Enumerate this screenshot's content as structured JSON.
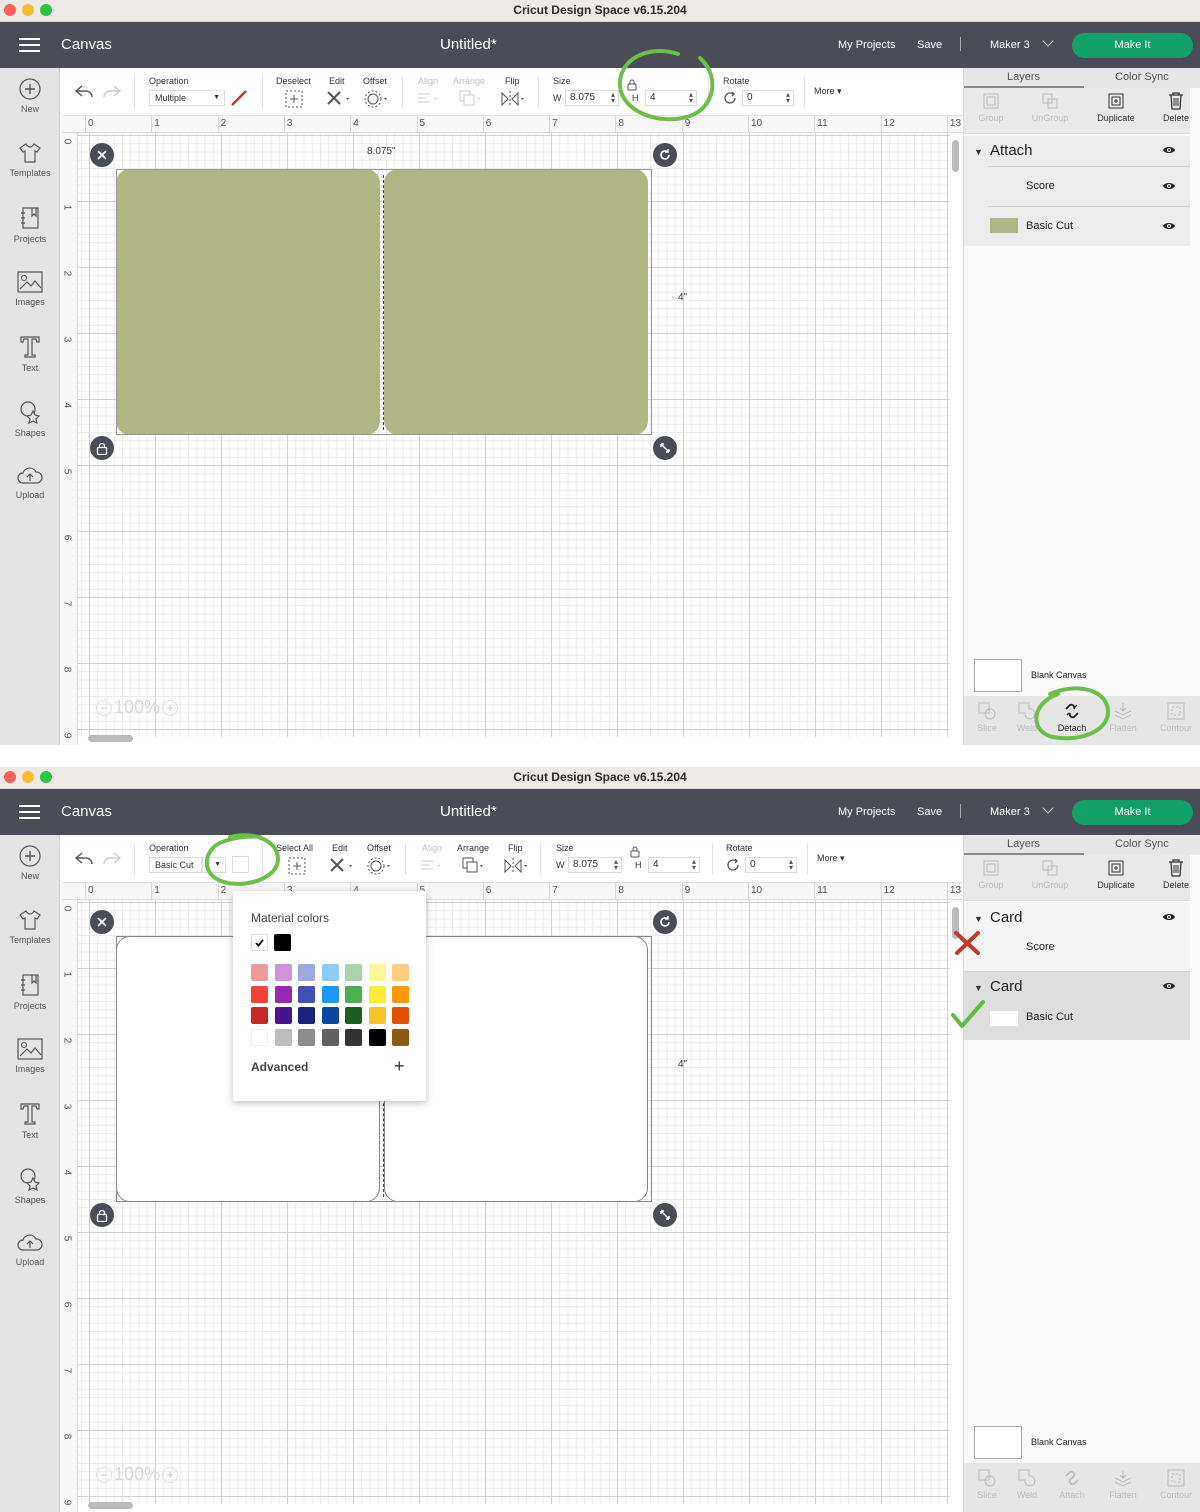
{
  "screenshots": [
    {
      "window_title": "Cricut Design Space  v6.15.204",
      "app": {
        "section": "Canvas",
        "document_title": "Untitled*",
        "my_projects": "My Projects",
        "save": "Save",
        "machine": "Maker 3",
        "make_it": "Make It"
      },
      "left_nav": [
        {
          "label": "New",
          "icon": "plus-circle-icon"
        },
        {
          "label": "Templates",
          "icon": "tshirt-icon"
        },
        {
          "label": "Projects",
          "icon": "notebook-icon"
        },
        {
          "label": "Images",
          "icon": "image-icon"
        },
        {
          "label": "Text",
          "icon": "text-t-icon"
        },
        {
          "label": "Shapes",
          "icon": "shapes-icon"
        },
        {
          "label": "Upload",
          "icon": "cloud-upload-icon"
        }
      ],
      "toolbar": {
        "operation_label": "Operation",
        "operation_value": "Multiple",
        "select_label": "Deselect",
        "edit_label": "Edit",
        "offset_label": "Offset",
        "align_label": "Align",
        "arrange_label": "Arrange",
        "flip_label": "Flip",
        "size_label": "Size",
        "w_label": "W",
        "w_value": "8.075",
        "h_label": "H",
        "h_value": "4",
        "rotate_label": "Rotate",
        "rotate_value": "0",
        "more_label": "More"
      },
      "ruler_h": [
        "0",
        "1",
        "2",
        "3",
        "4",
        "5",
        "6",
        "7",
        "8",
        "9",
        "10",
        "11",
        "12",
        "13"
      ],
      "ruler_v": [
        "0",
        "1",
        "2",
        "3",
        "4",
        "5",
        "6",
        "7",
        "8",
        "9"
      ],
      "canvas": {
        "width_label": "8.075\"",
        "height_label": "4\"",
        "zoom": "100%",
        "design_fill": "#b0b584"
      },
      "layers_panel": {
        "tab_layers": "Layers",
        "tab_color_sync": "Color Sync",
        "actions": [
          "Group",
          "UnGroup",
          "Duplicate",
          "Delete"
        ],
        "groups": [
          {
            "title": "Attach",
            "items": [
              {
                "label": "Score",
                "swatch": null
              },
              {
                "label": "Basic Cut",
                "swatch": "#b0b584"
              }
            ]
          }
        ],
        "canvas_label": "Blank Canvas",
        "bottom_actions": [
          "Slice",
          "Weld",
          "Detach",
          "Flatten",
          "Contour"
        ],
        "active_bottom_action": "Detach"
      },
      "annotations": [
        "size-lock-circled",
        "detach-circled"
      ]
    },
    {
      "window_title": "Cricut Design Space  v6.15.204",
      "app": {
        "section": "Canvas",
        "document_title": "Untitled*",
        "my_projects": "My Projects",
        "save": "Save",
        "machine": "Maker 3",
        "make_it": "Make It"
      },
      "left_nav": [
        {
          "label": "New",
          "icon": "plus-circle-icon"
        },
        {
          "label": "Templates",
          "icon": "tshirt-icon"
        },
        {
          "label": "Projects",
          "icon": "notebook-icon"
        },
        {
          "label": "Images",
          "icon": "image-icon"
        },
        {
          "label": "Text",
          "icon": "text-t-icon"
        },
        {
          "label": "Shapes",
          "icon": "shapes-icon"
        },
        {
          "label": "Upload",
          "icon": "cloud-upload-icon"
        }
      ],
      "toolbar": {
        "operation_label": "Operation",
        "operation_value": "Basic Cut",
        "select_label": "Select All",
        "edit_label": "Edit",
        "offset_label": "Offset",
        "align_label": "Align",
        "arrange_label": "Arrange",
        "flip_label": "Flip",
        "size_label": "Size",
        "w_label": "W",
        "w_value": "8.075",
        "h_label": "H",
        "h_value": "4",
        "rotate_label": "Rotate",
        "rotate_value": "0",
        "more_label": "More"
      },
      "ruler_h": [
        "0",
        "1",
        "2",
        "3",
        "4",
        "5",
        "6",
        "7",
        "8",
        "9",
        "10",
        "11",
        "12",
        "13"
      ],
      "ruler_v": [
        "0",
        "1",
        "2",
        "3",
        "4",
        "5",
        "6",
        "7",
        "8",
        "9"
      ],
      "canvas": {
        "width_label": "8.075\"",
        "height_label": "4\"",
        "zoom": "100%",
        "design_fill": "#ffffff"
      },
      "color_popover": {
        "title": "Material colors",
        "selected": "#ffffff",
        "recent": [
          "#ffffff",
          "#000000"
        ],
        "palette": [
          [
            "#ef9a9a",
            "#ce93d8",
            "#9fa8da",
            "#90caf9",
            "#a5d6a7",
            "#fff59d",
            "#ffcc80"
          ],
          [
            "#f44336",
            "#9c27b0",
            "#3f51b5",
            "#2196f3",
            "#4caf50",
            "#ffeb3b",
            "#ff9800"
          ],
          [
            "#c62828",
            "#4a148c",
            "#1a237e",
            "#0d47a1",
            "#1b5e20",
            "#fbc02d",
            "#e65100"
          ],
          [
            "#ffffff",
            "#bdbdbd",
            "#8d8d8d",
            "#616161",
            "#333333",
            "#000000",
            "#8d5a12"
          ]
        ],
        "advanced_label": "Advanced"
      },
      "layers_panel": {
        "tab_layers": "Layers",
        "tab_color_sync": "Color Sync",
        "actions": [
          "Group",
          "UnGroup",
          "Duplicate",
          "Delete"
        ],
        "groups": [
          {
            "title": "Card",
            "items": [
              {
                "label": "Score",
                "swatch": null
              }
            ],
            "mark": "red-x"
          },
          {
            "title": "Card",
            "items": [
              {
                "label": "Basic Cut",
                "swatch": "#ffffff"
              }
            ],
            "mark": "green-check"
          }
        ],
        "canvas_label": "Blank Canvas",
        "bottom_actions": [
          "Slice",
          "Weld",
          "Attach",
          "Flatten",
          "Contour"
        ],
        "active_bottom_action": null
      },
      "annotations": [
        "operation-color-circled"
      ]
    }
  ]
}
